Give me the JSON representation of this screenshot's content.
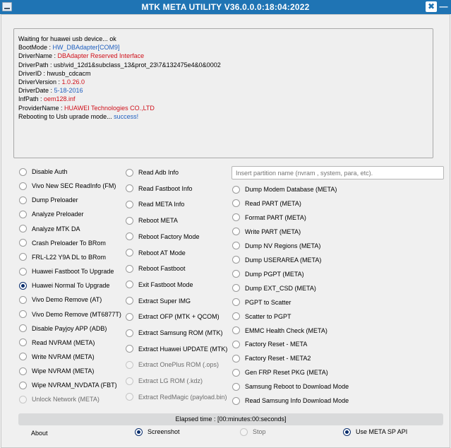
{
  "window": {
    "title": "MTK META UTILITY V36.0.0.0:18:04:2022",
    "close_glyph": "✖",
    "minimize_glyph": "—"
  },
  "log": [
    {
      "label": "Waiting for huawei usb device... ok",
      "value": "",
      "color": "black"
    },
    {
      "label": "BootMode : ",
      "value": "HW_DBAdapter[COM9]",
      "color": "blue"
    },
    {
      "label": "DriverName : ",
      "value": "DBAdapter Reserved Interface",
      "color": "red"
    },
    {
      "label": "DriverPath : usb\\vid_12d1&subclass_13&prot_23\\7&132475e4&0&0002",
      "value": "",
      "color": "black"
    },
    {
      "label": "DriverID : hwusb_cdcacm",
      "value": "",
      "color": "black"
    },
    {
      "label": "DriverVersion : ",
      "value": "1.0.26.0",
      "color": "red"
    },
    {
      "label": "DriverDate : ",
      "value": "5-18-2016",
      "color": "blue"
    },
    {
      "label": "InfPath : ",
      "value": "oem128.inf",
      "color": "red"
    },
    {
      "label": "ProviderName : ",
      "value": "HUAWEI Technologies CO.,LTD",
      "color": "red"
    },
    {
      "label": "Rebooting to Usb uprade mode... ",
      "value": "success!",
      "color": "blue"
    }
  ],
  "partition_input": {
    "value": "",
    "placeholder": "Insert partition name (nvram , system, para, etc)."
  },
  "col1": [
    {
      "label": "Disable Auth",
      "checked": false,
      "disabled": false
    },
    {
      "label": "Vivo New SEC ReadInfo (FM)",
      "checked": false,
      "disabled": false
    },
    {
      "label": "Dump Preloader",
      "checked": false,
      "disabled": false
    },
    {
      "label": "Analyze Preloader",
      "checked": false,
      "disabled": false
    },
    {
      "label": "Analyze MTK DA",
      "checked": false,
      "disabled": false
    },
    {
      "label": "Crash Preloader To BRom",
      "checked": false,
      "disabled": false
    },
    {
      "label": "FRL-L22 Y9A DL to BRom",
      "checked": false,
      "disabled": false
    },
    {
      "label": "Huawei Fastboot To Upgrade",
      "checked": false,
      "disabled": false
    },
    {
      "label": "Huawei Normal To Upgrade",
      "checked": true,
      "disabled": false
    },
    {
      "label": "Vivo Demo Remove (AT)",
      "checked": false,
      "disabled": false
    },
    {
      "label": "Vivo Demo Remove (MT6877T)",
      "checked": false,
      "disabled": false
    },
    {
      "label": "Disable Payjoy APP (ADB)",
      "checked": false,
      "disabled": false
    },
    {
      "label": "Read NVRAM (META)",
      "checked": false,
      "disabled": false
    },
    {
      "label": "Write NVRAM (META)",
      "checked": false,
      "disabled": false
    },
    {
      "label": "Wipe NVRAM (META)",
      "checked": false,
      "disabled": false
    },
    {
      "label": "Wipe NVRAM_NVDATA (FBT)",
      "checked": false,
      "disabled": false
    },
    {
      "label": "Unlock Network (META)",
      "checked": false,
      "disabled": true
    }
  ],
  "col2": [
    {
      "label": "Read Adb Info",
      "checked": false,
      "disabled": false
    },
    {
      "label": "Read Fastboot Info",
      "checked": false,
      "disabled": false
    },
    {
      "label": "Read META Info",
      "checked": false,
      "disabled": false
    },
    {
      "label": "Reboot META",
      "checked": false,
      "disabled": false
    },
    {
      "label": "Reboot Factory Mode",
      "checked": false,
      "disabled": false
    },
    {
      "label": "Reboot AT Mode",
      "checked": false,
      "disabled": false
    },
    {
      "label": "Reboot Fastboot",
      "checked": false,
      "disabled": false
    },
    {
      "label": "Exit Fastboot Mode",
      "checked": false,
      "disabled": false
    },
    {
      "label": "Extract Super IMG",
      "checked": false,
      "disabled": false
    },
    {
      "label": "Extract OFP (MTK + QCOM)",
      "checked": false,
      "disabled": false
    },
    {
      "label": "Extract Samsung ROM (MTK)",
      "checked": false,
      "disabled": false
    },
    {
      "label": "Extract Huawei UPDATE (MTK)",
      "checked": false,
      "disabled": false
    },
    {
      "label": "Extract OnePlus ROM (.ops)",
      "checked": false,
      "disabled": true
    },
    {
      "label": "Extract LG ROM (.kdz)",
      "checked": false,
      "disabled": true
    },
    {
      "label": "Extract RedMagic (payload.bin)",
      "checked": false,
      "disabled": true
    }
  ],
  "col3": [
    {
      "label": "Dump Modem Database (META)",
      "checked": false,
      "disabled": false
    },
    {
      "label": "Read PART (META)",
      "checked": false,
      "disabled": false
    },
    {
      "label": "Format PART (META)",
      "checked": false,
      "disabled": false
    },
    {
      "label": "Write PART (META)",
      "checked": false,
      "disabled": false
    },
    {
      "label": "Dump NV Regions (META)",
      "checked": false,
      "disabled": false
    },
    {
      "label": "Dump USERAREA (META)",
      "checked": false,
      "disabled": false
    },
    {
      "label": "Dump PGPT (META)",
      "checked": false,
      "disabled": false
    },
    {
      "label": "Dump  EXT_CSD (META)",
      "checked": false,
      "disabled": false
    },
    {
      "label": "PGPT to Scatter",
      "checked": false,
      "disabled": false
    },
    {
      "label": "Scatter to PGPT",
      "checked": false,
      "disabled": false
    },
    {
      "label": "EMMC Health Check (META)",
      "checked": false,
      "disabled": false
    },
    {
      "label": "Factory Reset - META",
      "checked": false,
      "disabled": false
    },
    {
      "label": "Factory Reset - META2",
      "checked": false,
      "disabled": false
    },
    {
      "label": "Gen FRP Reset PKG (META)",
      "checked": false,
      "disabled": false
    },
    {
      "label": "Samsung Reboot to Download Mode",
      "checked": false,
      "disabled": false
    },
    {
      "label": "Read Samsung Info Download Mode",
      "checked": false,
      "disabled": false
    }
  ],
  "status": {
    "elapsed": "Elapsed time : [00:minutes:00:seconds]"
  },
  "bottom": {
    "about": "About",
    "screenshot": {
      "label": "Screenshot",
      "checked": true,
      "disabled": false
    },
    "stop": {
      "label": "Stop",
      "checked": false,
      "disabled": true
    },
    "meta_sp_api": {
      "label": "Use META SP API",
      "checked": true,
      "disabled": false
    }
  }
}
